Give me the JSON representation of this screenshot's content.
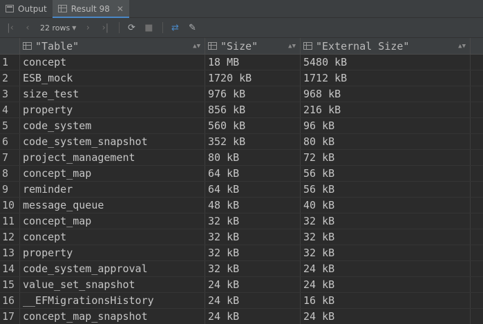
{
  "tabs": [
    {
      "label": "Output",
      "icon": "console-icon"
    },
    {
      "label": "Result 98",
      "icon": "table-icon",
      "close": "✕"
    }
  ],
  "toolbar": {
    "rows_label": "22 rows",
    "icons": [
      "first-page-icon",
      "prev-page-icon",
      "next-page-icon",
      "last-page-icon",
      "refresh-icon",
      "stop-icon",
      "compare-icon",
      "pin-icon"
    ]
  },
  "columns": [
    "\"Table\"",
    "\"Size\"",
    "\"External Size\""
  ],
  "rows": [
    {
      "n": "1",
      "table": "concept",
      "size": "18 MB",
      "ext": "5480 kB"
    },
    {
      "n": "2",
      "table": "ESB_mock",
      "size": "1720 kB",
      "ext": "1712 kB"
    },
    {
      "n": "3",
      "table": "size_test",
      "size": "976 kB",
      "ext": "968 kB"
    },
    {
      "n": "4",
      "table": "property",
      "size": "856 kB",
      "ext": "216 kB"
    },
    {
      "n": "5",
      "table": "code_system",
      "size": "560 kB",
      "ext": "96 kB"
    },
    {
      "n": "6",
      "table": "code_system_snapshot",
      "size": "352 kB",
      "ext": "80 kB"
    },
    {
      "n": "7",
      "table": "project_management",
      "size": "80 kB",
      "ext": "72 kB"
    },
    {
      "n": "8",
      "table": "concept_map",
      "size": "64 kB",
      "ext": "56 kB"
    },
    {
      "n": "9",
      "table": "reminder",
      "size": "64 kB",
      "ext": "56 kB"
    },
    {
      "n": "10",
      "table": "message_queue",
      "size": "48 kB",
      "ext": "40 kB"
    },
    {
      "n": "11",
      "table": "concept_map",
      "size": "32 kB",
      "ext": "32 kB"
    },
    {
      "n": "12",
      "table": "concept",
      "size": "32 kB",
      "ext": "32 kB"
    },
    {
      "n": "13",
      "table": "property",
      "size": "32 kB",
      "ext": "32 kB"
    },
    {
      "n": "14",
      "table": "code_system_approval",
      "size": "32 kB",
      "ext": "24 kB"
    },
    {
      "n": "15",
      "table": "value_set_snapshot",
      "size": "24 kB",
      "ext": "24 kB"
    },
    {
      "n": "16",
      "table": "__EFMigrationsHistory",
      "size": "24 kB",
      "ext": "16 kB"
    },
    {
      "n": "17",
      "table": "concept_map_snapshot",
      "size": "24 kB",
      "ext": "24 kB"
    }
  ]
}
